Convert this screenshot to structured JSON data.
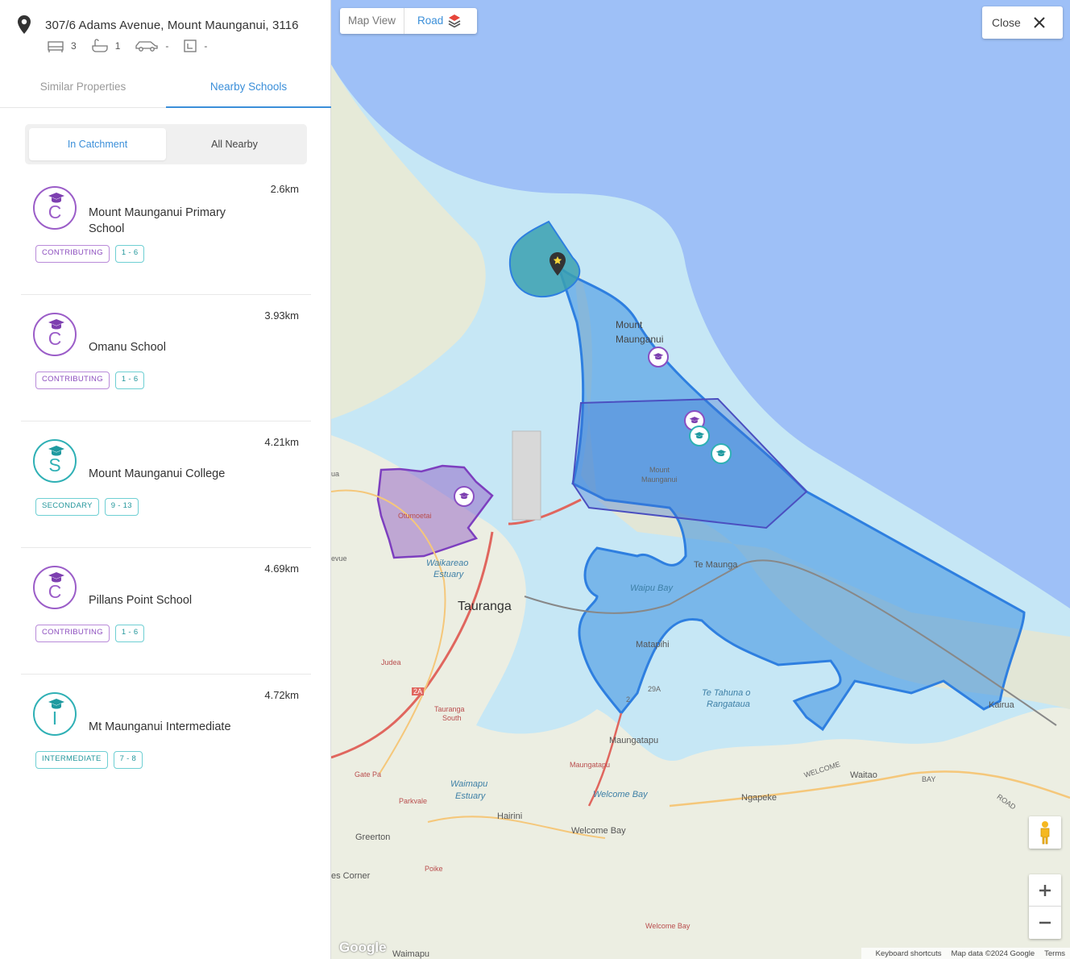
{
  "property": {
    "address": "307/6 Adams Avenue, Mount Maunganui, 3116",
    "bedrooms": "3",
    "bathrooms": "1",
    "parking": "-",
    "floor_area": "-"
  },
  "tabs": {
    "similar": "Similar Properties",
    "nearby": "Nearby Schools"
  },
  "filter": {
    "in_catchment": "In Catchment",
    "all_nearby": "All Nearby"
  },
  "schools": [
    {
      "name": "Mount Maunganui Primary School",
      "distance": "2.6km",
      "letter": "C",
      "type": "CONTRIBUTING",
      "years": "1 - 6",
      "color": "purple"
    },
    {
      "name": "Omanu School",
      "distance": "3.93km",
      "letter": "C",
      "type": "CONTRIBUTING",
      "years": "1 - 6",
      "color": "purple"
    },
    {
      "name": "Mount Maunganui College",
      "distance": "4.21km",
      "letter": "S",
      "type": "SECONDARY",
      "years": "9 - 13",
      "color": "teal"
    },
    {
      "name": "Pillans Point School",
      "distance": "4.69km",
      "letter": "C",
      "type": "CONTRIBUTING",
      "years": "1 - 6",
      "color": "purple"
    },
    {
      "name": "Mt Maunganui Intermediate",
      "distance": "4.72km",
      "letter": "I",
      "type": "INTERMEDIATE",
      "years": "7 - 8",
      "color": "teal"
    }
  ],
  "map": {
    "view_label": "Map View",
    "road_label": "Road",
    "close_label": "Close",
    "labels": {
      "mount": "Mount",
      "maunganui": "Maunganui",
      "mount_small": "Mount",
      "maunganui_small": "Maunganui",
      "te_maunga": "Te Maunga",
      "waipu_bay": "Waipu Bay",
      "matapihi": "Matapihi",
      "te_tahuna": "Te Tahuna o",
      "rangataua": "Rangataua",
      "otumoetai": "Otumoetai",
      "waikareao": "Waikareao",
      "estuary1": "Estuary",
      "tauranga": "Tauranga",
      "judea": "Judea",
      "tauranga_south1": "Tauranga",
      "tauranga_south2": "South",
      "maungatapu": "Maungatapu",
      "maungatapu_red": "Maungatapu",
      "waimapu": "Waimapu",
      "estuary2": "Estuary",
      "welcome_bay_water": "Welcome Bay",
      "gate_pa": "Gate Pa",
      "parkvale": "Parkvale",
      "hairini": "Hairini",
      "welcome_bay": "Welcome Bay",
      "greerton": "Greerton",
      "poike": "Poike",
      "es_corner": "es Corner",
      "welcome_bay_red": "Welcome Bay",
      "ngapeke": "Ngapeke",
      "waitao": "Waitao",
      "kairua": "Kairua",
      "welcome_road": "WELCOME",
      "bay_road": "BAY",
      "road_road": "ROAD",
      "hw2a": "2A",
      "hw29a": "29A",
      "hw2": "2",
      "waimapu_bottom": "Waimapu",
      "a_left": "ua",
      "evue": "evue"
    },
    "attribution": {
      "google": "Google",
      "shortcuts": "Keyboard shortcuts",
      "data": "Map data ©2024 Google",
      "terms": "Terms"
    }
  },
  "colors": {
    "accent": "#3b8fd9",
    "school_purple": "#9b5dc8",
    "school_teal": "#2fb0b5",
    "catchment_blue": "#3a8fe0",
    "catchment_purple": "#8a4fc2",
    "ocean": "#9ec0f7",
    "harbour": "#c6e7f5",
    "land": "#eef0e4"
  }
}
